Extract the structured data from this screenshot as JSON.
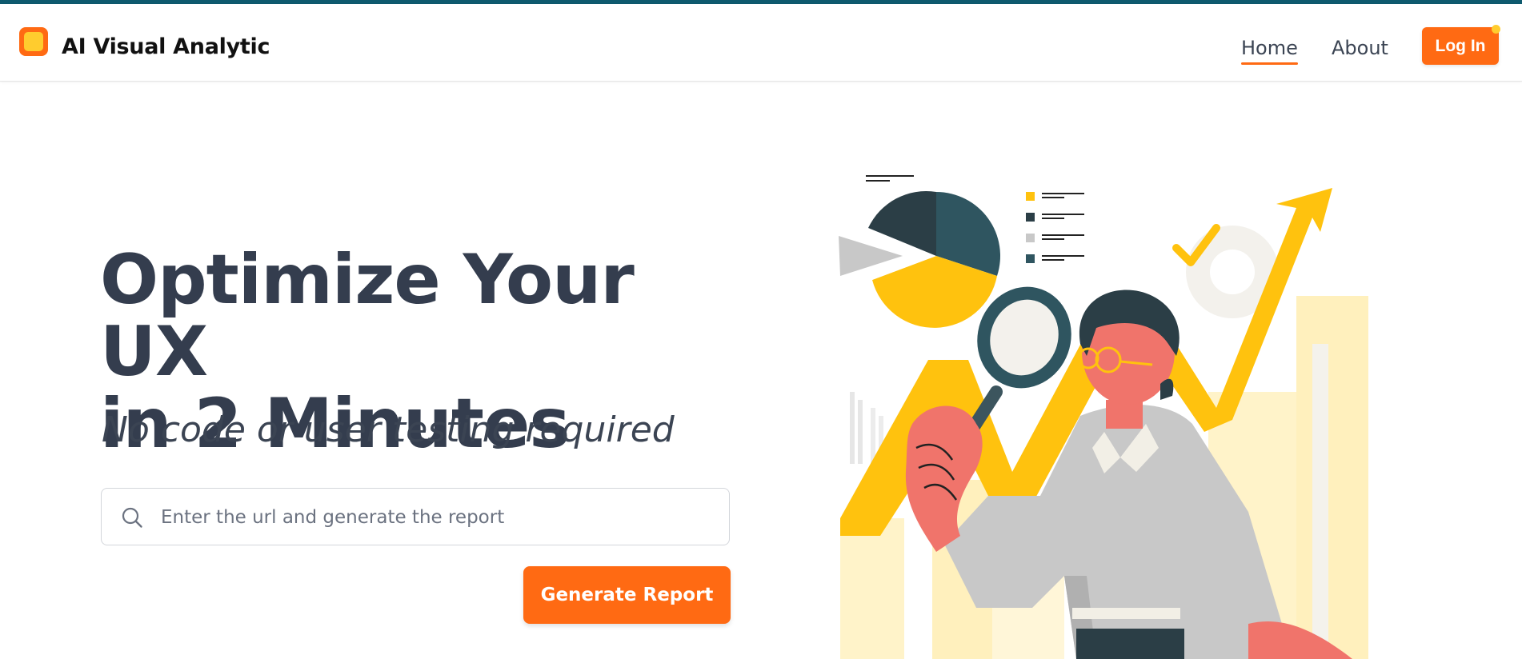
{
  "header": {
    "brand": "AI Visual Analytic",
    "nav": {
      "home": "Home",
      "about": "About"
    },
    "login_label": "Log In"
  },
  "hero": {
    "title_line1": "Optimize Your UX",
    "title_line2": "in 2 Minutes",
    "subtitle": "No code or user testing required",
    "search": {
      "placeholder": "Enter the url and generate the report",
      "value": ""
    },
    "generate_label": "Generate Report"
  },
  "colors": {
    "accent": "#ff6a13",
    "accent_secondary": "#ffcc2e",
    "top_strip": "#0e5a6e",
    "heading": "#343d4e"
  },
  "icons": {
    "logo": "app-logo-icon",
    "search": "search-icon",
    "illustration": "analytics-illustration"
  }
}
